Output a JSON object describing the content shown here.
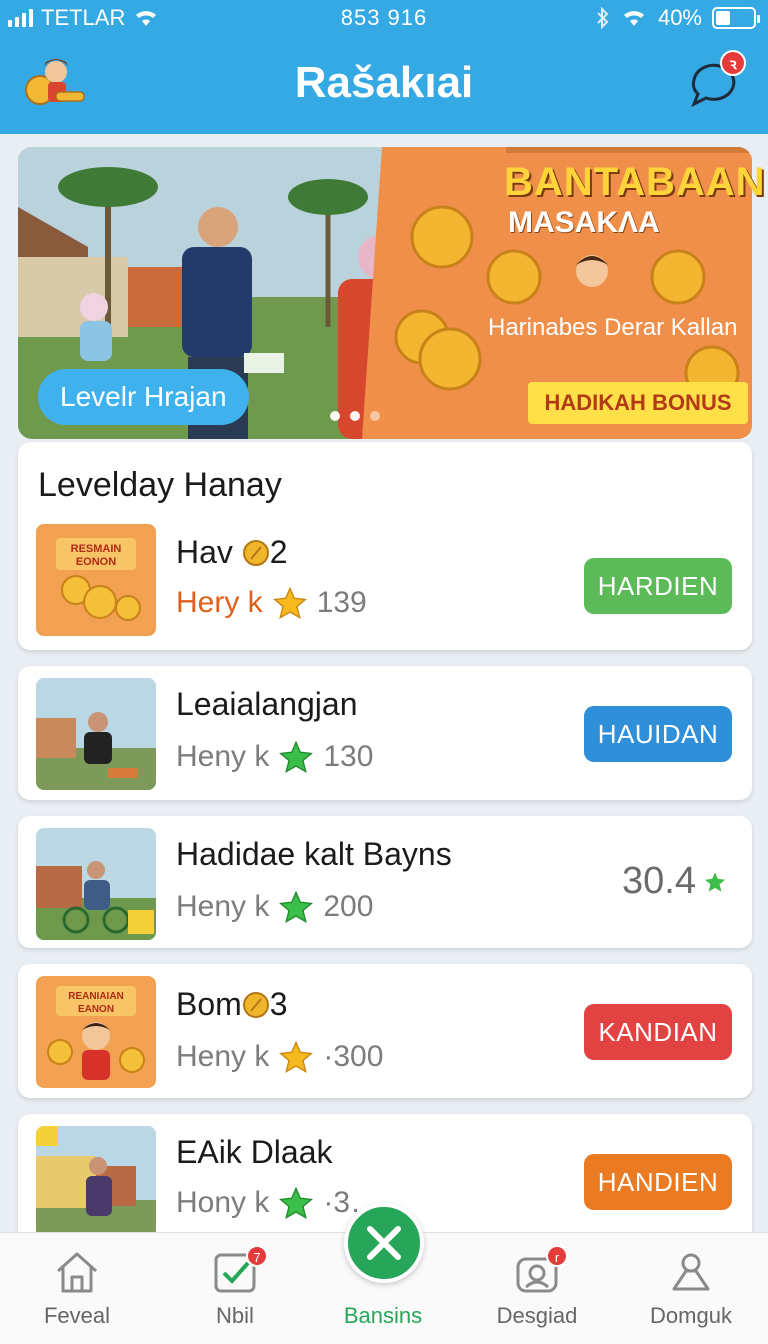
{
  "status_bar": {
    "carrier": "TETLAR",
    "time": "853 916",
    "battery": "40%",
    "battery_level": 0.4
  },
  "header": {
    "title": "Rašakıai",
    "chat_badge": "ꝛ"
  },
  "banner": {
    "pill_label": "Levelr Hrajan",
    "promo_title": "BANTABAAN",
    "promo_subtitle": "MASAKΛA",
    "promo_text": "Harinabes Derar Kallan",
    "ribbon": "HADIKAH BONUS"
  },
  "section": {
    "title": "Levelday Hanay"
  },
  "rows": [
    {
      "title": "Hav",
      "title_suffix": "2",
      "label": "Hery k",
      "value": "139",
      "action": "HARDIEN",
      "action_color": "#5cbb58",
      "icon": "gold-star"
    },
    {
      "title": "Leaialangjan",
      "title_suffix": "",
      "label": "Heny k",
      "value": "130",
      "action": "HAUIDAN",
      "action_color": "#2f8fd8",
      "icon": "green-star"
    },
    {
      "title": "Hadidae kalt Bayns",
      "title_suffix": "",
      "label": "Heny k",
      "value": "200",
      "right_value": "30.4",
      "icon": "green-star"
    },
    {
      "title": "Bom",
      "title_suffix": "3",
      "label": "Heny k",
      "value": "·300",
      "action": "KANDIAN",
      "action_color": "#e34242",
      "icon": "gold-star"
    },
    {
      "title": "EAik Dlaak",
      "title_suffix": "",
      "label": "Hony k",
      "value": "·3…",
      "action": "HANDIEN",
      "action_color": "#ea7b23",
      "icon": "green-star"
    }
  ],
  "thumb_text": {
    "row1_top": "RESMAIN",
    "row1_bottom": "EONON",
    "row4_top": "REANIAIAN",
    "row4_bottom": "EANON"
  },
  "nav": [
    {
      "label": "Feveal",
      "icon": "home-icon"
    },
    {
      "label": "Nbil",
      "icon": "checkbox-icon",
      "badge": "7"
    },
    {
      "label": "Bansins",
      "icon": "close-icon"
    },
    {
      "label": "Desgiad",
      "icon": "gift-icon",
      "badge": "r"
    },
    {
      "label": "Domguk",
      "icon": "person-icon"
    }
  ]
}
